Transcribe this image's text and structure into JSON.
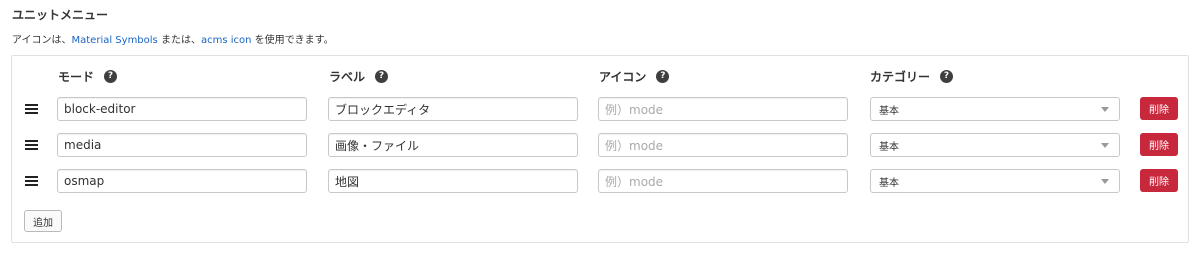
{
  "section": {
    "title": "ユニットメニュー",
    "desc_prefix": "アイコンは、",
    "link1": "Material Symbols",
    "desc_mid": " または、",
    "link2": "acms icon",
    "desc_suffix": " を使用できます。"
  },
  "headers": {
    "mode": "モード",
    "label": "ラベル",
    "icon": "アイコン",
    "category": "カテゴリー",
    "help_glyph": "?"
  },
  "rows": [
    {
      "mode": "block-editor",
      "label": "ブロックエディタ",
      "icon_placeholder": "例）mode",
      "category": "基本",
      "delete": "削除"
    },
    {
      "mode": "media",
      "label": "画像・ファイル",
      "icon_placeholder": "例）mode",
      "category": "基本",
      "delete": "削除"
    },
    {
      "mode": "osmap",
      "label": "地図",
      "icon_placeholder": "例）mode",
      "category": "基本",
      "delete": "削除"
    }
  ],
  "add_button": "追加",
  "colors": {
    "link": "#1a66c2",
    "danger": "#c8283c",
    "help_icon": "#3f3f3f"
  },
  "icons": {
    "handle": "drag-handle-icon",
    "help": "help-circle-icon",
    "select_caret": "chevron-down-icon"
  }
}
